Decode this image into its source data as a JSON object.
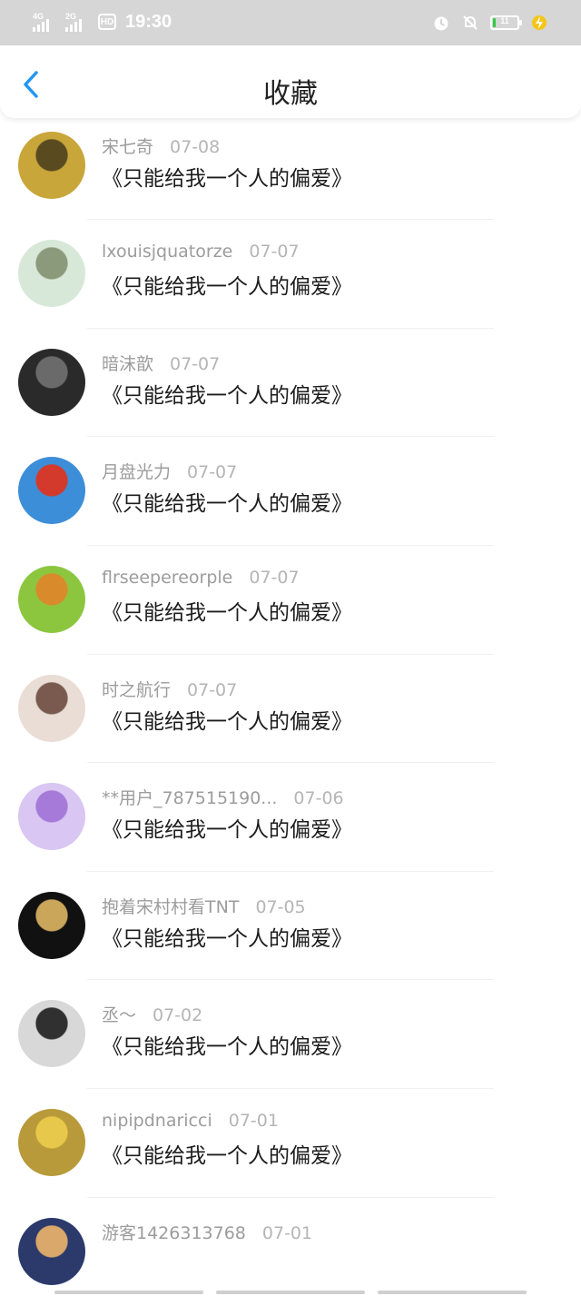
{
  "status_bar": {
    "network1": "4G",
    "network2": "2G",
    "hd": "HD",
    "time": "19:30",
    "battery_level": "11",
    "battery_fraction": 0.11
  },
  "header": {
    "title": "收藏",
    "back_icon": "chevron-left-icon",
    "accent_color": "#2196f3"
  },
  "items": [
    {
      "user": "",
      "date": "",
      "message": "《只能给我一个人的偏爱》"
    },
    {
      "user": "宋七奇",
      "date": "07-08",
      "message": "《只能给我一个人的偏爱》"
    },
    {
      "user": "lxouisjquatorze",
      "date": "07-07",
      "message": "《只能给我一个人的偏爱》"
    },
    {
      "user": "暗沫歆",
      "date": "07-07",
      "message": "《只能给我一个人的偏爱》"
    },
    {
      "user": "月盘光力",
      "date": "07-07",
      "message": "《只能给我一个人的偏爱》"
    },
    {
      "user": "flrseepereorple",
      "date": "07-07",
      "message": "《只能给我一个人的偏爱》"
    },
    {
      "user": "时之航行",
      "date": "07-07",
      "message": "《只能给我一个人的偏爱》"
    },
    {
      "user": "**用户_787515190...",
      "date": "07-06",
      "message": "《只能给我一个人的偏爱》"
    },
    {
      "user": "抱着宋村村看TNT",
      "date": "07-05",
      "message": "《只能给我一个人的偏爱》"
    },
    {
      "user": "丞～",
      "date": "07-02",
      "message": "《只能给我一个人的偏爱》"
    },
    {
      "user": "nipipdnaricci",
      "date": "07-01",
      "message": "《只能给我一个人的偏爱》"
    },
    {
      "user": "游客1426313768",
      "date": "07-01",
      "message": ""
    }
  ]
}
